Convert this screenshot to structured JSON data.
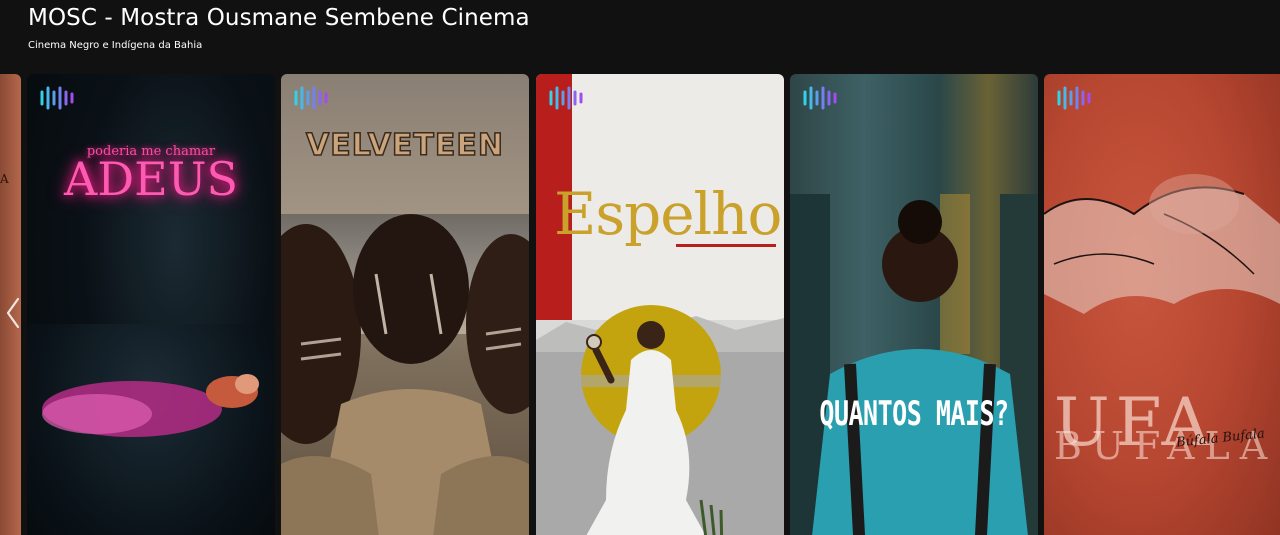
{
  "header": {
    "title": "MOSC - Mostra Ousmane Sembene Cinema",
    "subtitle": "Cinema Negro e Indígena da Bahia"
  },
  "carousel": {
    "prev_icon": "chevron-left-icon",
    "brand_icon": "waveform-logo-icon",
    "peek_letter": "A",
    "cards": [
      {
        "title": "ADEUS",
        "kicker": "poderia me chamar",
        "palette": [
          "#05080b",
          "#ff5ab2",
          "#e03aa0"
        ]
      },
      {
        "title": "VELVETEEN",
        "palette": [
          "#a69886",
          "#c9a47d",
          "#3a2a1c"
        ]
      },
      {
        "title": "Espelho",
        "palette": [
          "#ecebe8",
          "#c9a12b",
          "#b81f1c"
        ]
      },
      {
        "title": "QUANTOS MAIS?",
        "palette": [
          "#3e6165",
          "#ffffff",
          "#2a9fb0"
        ]
      },
      {
        "title": "UFA",
        "subtitle": "BUFALA",
        "signature": "Búfala Bufala",
        "palette": [
          "#b74731",
          "#ffe6dc"
        ]
      }
    ]
  },
  "colors": {
    "background": "#111111",
    "text": "#ffffff"
  }
}
